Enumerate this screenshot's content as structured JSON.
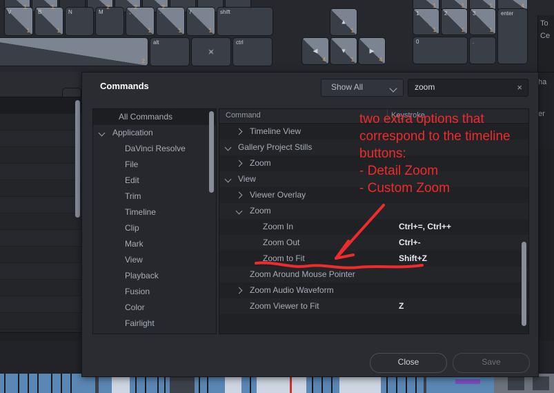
{
  "background": {
    "keyboard": {
      "row_top": [
        {
          "label": "",
          "count": "1"
        },
        {
          "label": "",
          "count": "1"
        },
        {
          "label": "",
          "count": ""
        },
        {
          "label": "",
          "count": "2"
        },
        {
          "label": "",
          "count": "2"
        },
        {
          "label": "",
          "count": "2"
        },
        {
          "label": "",
          "count": ""
        },
        {
          "label": "",
          "count": ""
        },
        {
          "label": "",
          "count": ""
        }
      ],
      "row_letters": [
        {
          "label": "V",
          "count": "1"
        },
        {
          "label": "B",
          "count": "1"
        },
        {
          "label": "N",
          "count": ""
        },
        {
          "label": "M",
          "count": ""
        },
        {
          "label": ",",
          "count": "1"
        },
        {
          "label": ".",
          "count": "1"
        },
        {
          "label": "/",
          "count": "1"
        },
        {
          "label": "shift",
          "count": ""
        }
      ],
      "row_bottom": [
        {
          "label": "",
          "count": "2"
        },
        {
          "label": "alt",
          "count": ""
        },
        {
          "label": "super-key-icon",
          "count": ""
        },
        {
          "label": "ctrl",
          "count": ""
        }
      ],
      "arrows": [
        {
          "label": "arrow-up-icon",
          "count": "1"
        },
        {
          "label": "arrow-left-icon",
          "count": "4"
        },
        {
          "label": "arrow-down-icon",
          "count": "1"
        },
        {
          "label": "arrow-right-icon",
          "count": "4"
        }
      ],
      "numpad": [
        {
          "label": "1",
          "count": "1"
        },
        {
          "label": "2",
          "count": "1"
        },
        {
          "label": "3",
          "count": "1"
        },
        {
          "label": "enter",
          "count": ""
        },
        {
          "label": "0",
          "count": ""
        },
        {
          "label": ".",
          "count": ""
        }
      ],
      "numpad_row_above": [
        {
          "label": "",
          "count": "1"
        },
        {
          "label": "",
          "count": "1"
        },
        {
          "label": "",
          "count": "1"
        },
        {
          "label": "",
          "count": "4"
        }
      ]
    },
    "right_panel": {
      "line1": "To",
      "line2": "Ce",
      "line3": "ha",
      "line4": "er"
    }
  },
  "dialog": {
    "title": "Commands",
    "filter": {
      "selected": "Show All",
      "options": [
        "Show All"
      ]
    },
    "search": {
      "value": "zoom",
      "placeholder": "",
      "clear_label": "×"
    },
    "categories": [
      {
        "label": "All Commands",
        "indent": 1,
        "arrow": "none",
        "selected": true
      },
      {
        "label": "Application",
        "indent": 0,
        "arrow": "open",
        "selected": false
      },
      {
        "label": "DaVinci Resolve",
        "indent": 2,
        "arrow": "none",
        "selected": false
      },
      {
        "label": "File",
        "indent": 2,
        "arrow": "none",
        "selected": false
      },
      {
        "label": "Edit",
        "indent": 2,
        "arrow": "none",
        "selected": false
      },
      {
        "label": "Trim",
        "indent": 2,
        "arrow": "none",
        "selected": false
      },
      {
        "label": "Timeline",
        "indent": 2,
        "arrow": "none",
        "selected": false
      },
      {
        "label": "Clip",
        "indent": 2,
        "arrow": "none",
        "selected": false
      },
      {
        "label": "Mark",
        "indent": 2,
        "arrow": "none",
        "selected": false
      },
      {
        "label": "View",
        "indent": 2,
        "arrow": "none",
        "selected": false
      },
      {
        "label": "Playback",
        "indent": 2,
        "arrow": "none",
        "selected": false
      },
      {
        "label": "Fusion",
        "indent": 2,
        "arrow": "none",
        "selected": false
      },
      {
        "label": "Color",
        "indent": 2,
        "arrow": "none",
        "selected": false
      },
      {
        "label": "Fairlight",
        "indent": 2,
        "arrow": "none",
        "selected": false
      }
    ],
    "table": {
      "columns": [
        "Command",
        "Keystroke"
      ],
      "rows": [
        {
          "command": "Timeline View",
          "keystroke": "",
          "indent": 2,
          "arrow": "closed"
        },
        {
          "command": "Gallery Project Stills",
          "keystroke": "",
          "indent": 1,
          "arrow": "open"
        },
        {
          "command": "Zoom",
          "keystroke": "",
          "indent": 2,
          "arrow": "closed"
        },
        {
          "command": "View",
          "keystroke": "",
          "indent": 1,
          "arrow": "open"
        },
        {
          "command": "Viewer Overlay",
          "keystroke": "",
          "indent": 2,
          "arrow": "closed"
        },
        {
          "command": "Zoom",
          "keystroke": "",
          "indent": 2,
          "arrow": "open"
        },
        {
          "command": "Zoom In",
          "keystroke": "Ctrl+=, Ctrl++",
          "indent": 3,
          "arrow": "none"
        },
        {
          "command": "Zoom Out",
          "keystroke": "Ctrl+-",
          "indent": 3,
          "arrow": "none"
        },
        {
          "command": "Zoom to Fit",
          "keystroke": "Shift+Z",
          "indent": 3,
          "arrow": "none"
        },
        {
          "command": "Zoom Around Mouse Pointer",
          "keystroke": "",
          "indent": 2,
          "arrow": "none"
        },
        {
          "command": "Zoom Audio Waveform",
          "keystroke": "",
          "indent": 2,
          "arrow": "closed"
        },
        {
          "command": "Zoom Viewer to Fit",
          "keystroke": "Z",
          "indent": 2,
          "arrow": "none"
        }
      ]
    },
    "footer": {
      "close_label": "Close",
      "save_label": "Save"
    }
  },
  "annotation": {
    "color": "#ef2b2b",
    "lines": [
      "two extra options that",
      "correspond to the timeline",
      "buttons:",
      "- Detail Zoom",
      "- Custom Zoom"
    ]
  }
}
